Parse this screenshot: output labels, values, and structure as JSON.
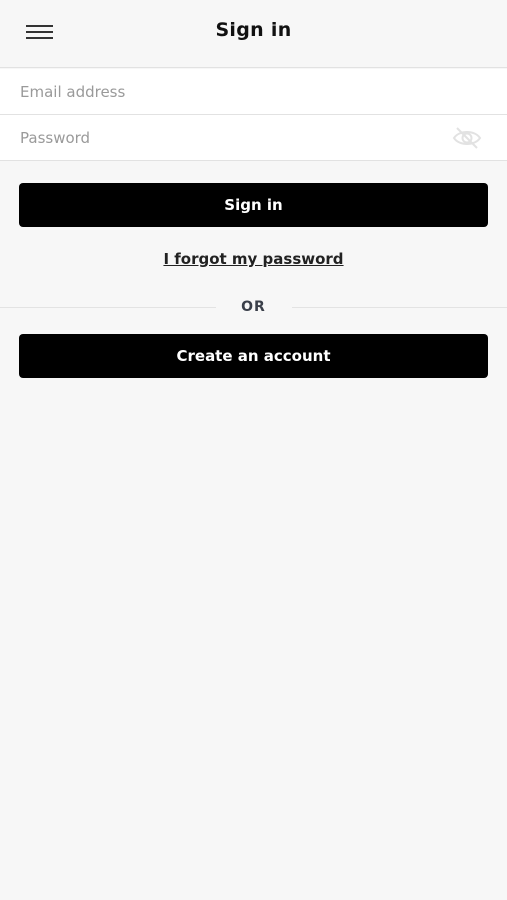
{
  "header": {
    "title": "Sign in",
    "menu_icon": "hamburger-menu-icon"
  },
  "form": {
    "email": {
      "placeholder": "Email address",
      "value": ""
    },
    "password": {
      "placeholder": "Password",
      "value": "",
      "toggle_icon": "eye-hidden-icon"
    },
    "signin_label": "Sign in",
    "forgot_label": "I forgot my password",
    "divider_label": "OR",
    "create_label": "Create an account"
  },
  "colors": {
    "background": "#f7f7f7",
    "button": "#000000",
    "button_text": "#ffffff"
  }
}
